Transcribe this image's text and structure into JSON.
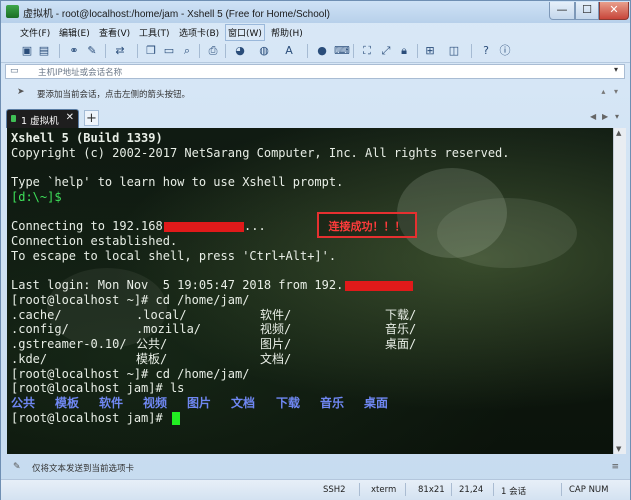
{
  "window": {
    "title": "虚拟机 - root@localhost:/home/jam - Xshell 5 (Free for Home/School)",
    "min_glyph": "—",
    "max_glyph": "☐",
    "close_glyph": "✕"
  },
  "menu": [
    {
      "label": "文件(F)"
    },
    {
      "label": "编辑(E)"
    },
    {
      "label": "查看(V)"
    },
    {
      "label": "工具(T)"
    },
    {
      "label": "选项卡(B)"
    },
    {
      "label": "窗口(W)"
    },
    {
      "label": "帮助(H)"
    }
  ],
  "toolbar_icons": [
    "new-session-icon",
    "open-folder-icon",
    "link-icon",
    "edit-properties-icon",
    "transfer-icon",
    "copy-icon",
    "paste-icon",
    "find-icon",
    "print-icon",
    "color-scheme-icon",
    "globe-icon",
    "font-icon",
    "bold-icon",
    "keyboard-icon",
    "script-icon",
    "fullscreen-icon",
    "lock-icon",
    "compose-icon",
    "add-tab-icon",
    "layout-icon",
    "help-icon",
    "info-icon"
  ],
  "address_bar": {
    "placeholder": "主机IP地址或会话名称",
    "dropdown_glyph": "▾"
  },
  "hint_bar": {
    "text": "要添加当前会话，点击左侧的箭头按钮。",
    "arrows": "▴ ▾"
  },
  "tabs": [
    {
      "label": "1 虚拟机",
      "close": "✕"
    }
  ],
  "tab_add": "+",
  "tab_nav": {
    "prev": "◀",
    "next": "▶",
    "menu": "▾"
  },
  "terminal": {
    "header_build": "Xshell 5 (Build 1339)",
    "header_copy": "Copyright (c) 2002-2017 NetSarang Computer, Inc. All rights reserved.",
    "help_line": "Type `help' to learn how to use Xshell prompt.",
    "local_prompt": "[d:\\~]$",
    "connecting": "Connecting to 192.168",
    "connecting_tail": "...",
    "established": "Connection established.",
    "escape": "To escape to local shell, press 'Ctrl+Alt+]'.",
    "last_login": "Last login: Mon Nov  5 19:05:47 2018 from 192.",
    "cmd_cd_home": "[root@localhost ~]# cd /home/jam/",
    "ls_rows": [
      {
        "c1": ".cache/",
        "c2": ".local/",
        "c3": "软件/",
        "c4": "下载/"
      },
      {
        "c1": ".config/",
        "c2": ".mozilla/",
        "c3": "视频/",
        "c4": "音乐/"
      },
      {
        "c1": ".gstreamer-0.10/",
        "c2": "公共/",
        "c3": "图片/",
        "c4": "桌面/"
      },
      {
        "c1": ".kde/",
        "c2": "模板/",
        "c3": "文档/",
        "c4": ""
      }
    ],
    "cmd_cd_home2": "[root@localhost ~]# cd /home/jam/",
    "cmd_ls": "[root@localhost jam]# ls",
    "ls_output": [
      "公共",
      "模板",
      "软件",
      "视频",
      "图片",
      "文档",
      "下载",
      "音乐",
      "桌面"
    ],
    "final_prompt": "[root@localhost jam]# ",
    "annotation": "连接成功！！！"
  },
  "compose_bar": {
    "text": "仅将文本发送到当前选项卡",
    "menu_glyph": "≡"
  },
  "status_bar": {
    "protocol": "SSH2",
    "terminal_type": "xterm",
    "size": "81x21",
    "position": "21,24",
    "sessions": "1 会话",
    "caps": "CAP NUM"
  },
  "colors": {
    "terminal_bg": "#0b120c",
    "prompt_green": "#3ee05a",
    "dir_blue": "#6f87f2",
    "redaction_red": "#e01a1a",
    "cursor_green": "#22ee22"
  }
}
